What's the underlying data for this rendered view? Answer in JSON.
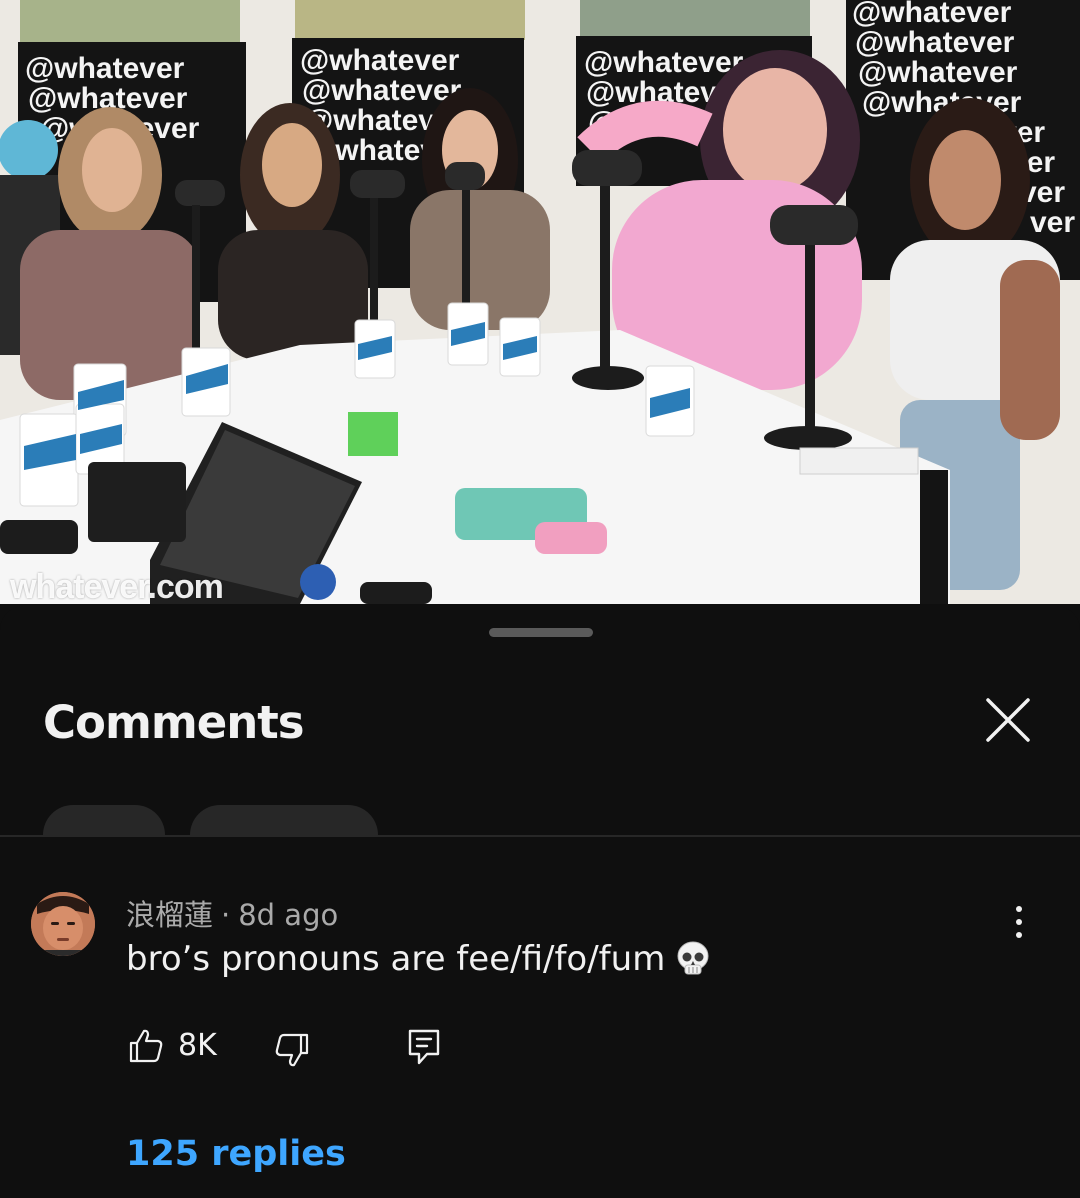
{
  "video": {
    "watermark": "whatever.com",
    "backdrop_handle": "@whatever"
  },
  "sheet": {
    "title": "Comments",
    "close_icon": "close-icon"
  },
  "comment": {
    "author": "浪榴蓮",
    "separator": "·",
    "time": "8d ago",
    "text": "bro’s pronouns are fee/fi/fo/fum",
    "emoji": "skull-emoji",
    "like_count": "8K",
    "replies_label": "125 replies"
  },
  "colors": {
    "background": "#0f0f0f",
    "text": "#f1f1f1",
    "secondary_text": "#aaaaaa",
    "link": "#3ea6ff"
  }
}
